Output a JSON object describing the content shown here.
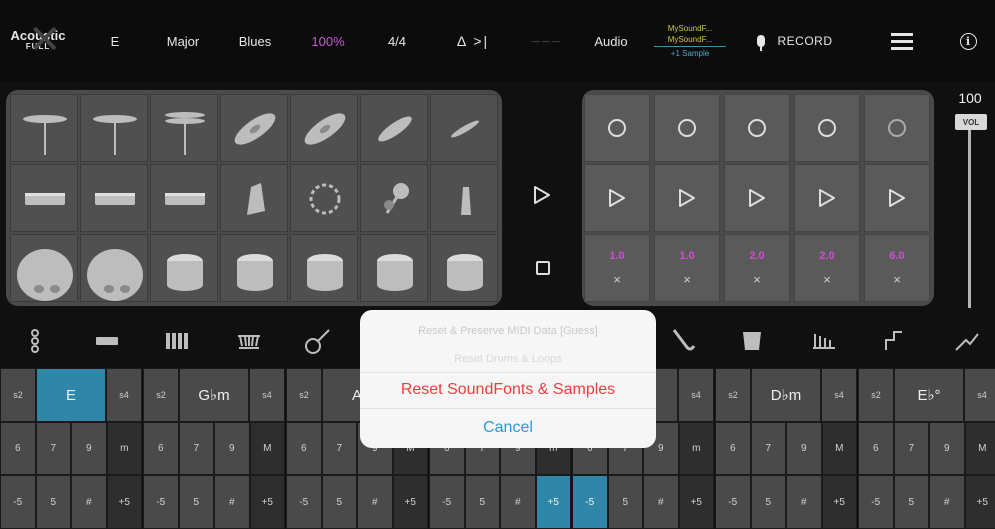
{
  "topbar": {
    "kit_line1": "Acoustic",
    "kit_line2": "FULL",
    "key": "E",
    "scale": "Major",
    "style": "Blues",
    "tempo": "100%",
    "meter": "4/4",
    "metronome": "Δ >|",
    "soundfont_1": "MySoundF...",
    "soundfont_2": "MySoundF...",
    "soundfont_3": "+1 Sample",
    "audio": "Audio",
    "record": "RECORD"
  },
  "drum_pads": [
    [
      "crash-cymbal",
      "crash-cymbal",
      "hihat",
      "ride-cymbal",
      "ride-cymbal",
      "splash-cymbal",
      "china-cymbal"
    ],
    [
      "snare",
      "snare",
      "snare",
      "shaker",
      "tambourine",
      "maracas",
      "cowbell"
    ],
    [
      "bass-drum",
      "bass-drum",
      "tom",
      "tom",
      "tom",
      "tom",
      "tom"
    ]
  ],
  "loops": [
    {
      "multiplier": "1.0",
      "clear": "×"
    },
    {
      "multiplier": "1.0",
      "clear": "×"
    },
    {
      "multiplier": "2.0",
      "clear": "×"
    },
    {
      "multiplier": "2.0",
      "clear": "×"
    },
    {
      "multiplier": "6.0",
      "clear": "×"
    }
  ],
  "volume": {
    "value": "100",
    "label": "VOL",
    "level": 1.0
  },
  "instruments": [
    "bass",
    "keys",
    "piano",
    "marimba",
    "guitar",
    "violin",
    "strings",
    "harp",
    "sax",
    "accordion",
    "vibes",
    "synth",
    "lead"
  ],
  "chord_groups": [
    {
      "root": "E",
      "l": "s2",
      "r": "s4",
      "nums": [
        "6",
        "7",
        "9",
        "m"
      ],
      "bot": [
        "-5",
        "5",
        "#",
        "+5"
      ],
      "highlight_root": true
    },
    {
      "root": "G♭m",
      "l": "s2",
      "r": "s4",
      "nums": [
        "6",
        "7",
        "9",
        "M"
      ],
      "bot": [
        "-5",
        "5",
        "#",
        "+5"
      ],
      "highlight_root": false
    },
    {
      "root": "A",
      "l": "s2",
      "r": "s4",
      "nums": [
        "6",
        "7",
        "9",
        "M"
      ],
      "bot": [
        "-5",
        "5",
        "#",
        "+5"
      ],
      "highlight_root": false
    },
    {
      "root": "",
      "l": "s2",
      "r": "s4",
      "nums": [
        "6",
        "7",
        "9",
        "m"
      ],
      "bot": [
        "-5",
        "5",
        "#",
        "+5"
      ],
      "highlight_root": false
    },
    {
      "root": "",
      "l": "s2",
      "r": "s4",
      "nums": [
        "6",
        "7",
        "9",
        "m"
      ],
      "bot": [
        "-5",
        "5",
        "#",
        "+5"
      ],
      "highlight_root": false
    },
    {
      "root": "D♭m",
      "l": "s2",
      "r": "s4",
      "nums": [
        "6",
        "7",
        "9",
        "M"
      ],
      "bot": [
        "-5",
        "5",
        "#",
        "+5"
      ],
      "highlight_root": false
    },
    {
      "root": "E♭°",
      "l": "s2",
      "r": "s4",
      "nums": [
        "6",
        "7",
        "9",
        "M"
      ],
      "bot": [
        "-5",
        "5",
        "#",
        "+5"
      ],
      "highlight_root": false
    }
  ],
  "modal": {
    "option_1": "Reset & Preserve MIDI Data [Guess]",
    "option_2": "Reset Drums & Loops",
    "reset_label": "Reset SoundFonts & Samples",
    "cancel_label": "Cancel"
  }
}
